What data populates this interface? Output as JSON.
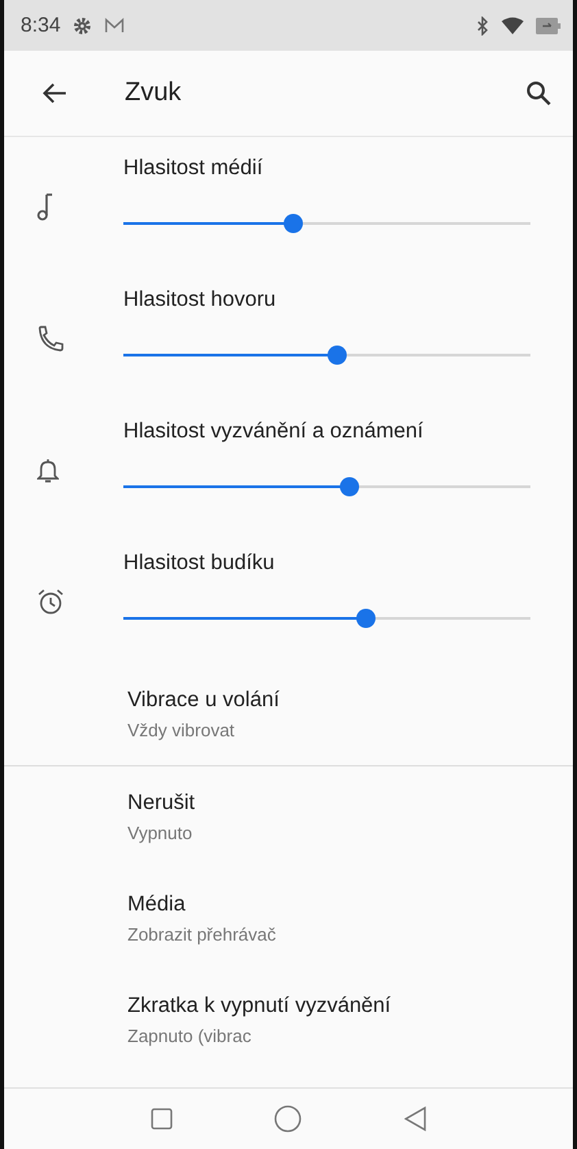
{
  "status_bar": {
    "time": "8:34"
  },
  "toolbar": {
    "title": "Zvuk"
  },
  "sliders": [
    {
      "kind": "media",
      "label": "Hlasitost médií",
      "level": 0.4
    },
    {
      "kind": "call",
      "label": "Hlasitost hovoru",
      "level": 0.5
    },
    {
      "kind": "ring",
      "label": "Hlasitost vyzvánění a oznámení",
      "level": 0.53
    },
    {
      "kind": "alarm",
      "label": "Hlasitost budíku",
      "level": 0.57
    }
  ],
  "vibrate_item": {
    "title": "Vibrace u volání",
    "summary": "Vždy vibrovat"
  },
  "items": [
    {
      "title": "Nerušit",
      "summary": "Vypnuto"
    },
    {
      "title": "Média",
      "summary": "Zobrazit přehrávač"
    },
    {
      "title": "Zkratka k vypnutí vyzvánění",
      "summary": "Zapnuto (vibrac"
    }
  ]
}
